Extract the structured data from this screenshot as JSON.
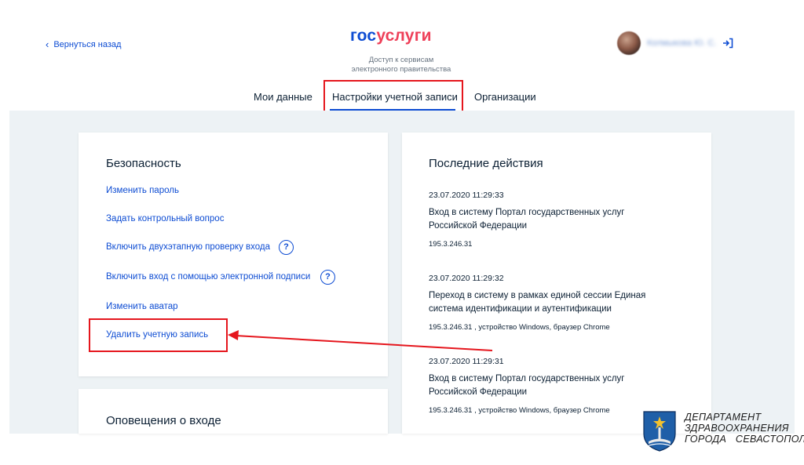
{
  "header": {
    "back_label": "Вернуться назад",
    "logo_part1": "гос",
    "logo_part2": "услуги",
    "tagline_line1": "Доступ к сервисам",
    "tagline_line2": "электронного правительства",
    "user_name": "Колмыкова Ю. С."
  },
  "tabs": [
    {
      "label": "Мои данные",
      "active": false
    },
    {
      "label": "Настройки учетной записи",
      "active": true
    },
    {
      "label": "Организации",
      "active": false
    }
  ],
  "security": {
    "title": "Безопасность",
    "links": [
      {
        "label": "Изменить пароль",
        "help": false
      },
      {
        "label": "Задать контрольный вопрос",
        "help": false
      },
      {
        "label": "Включить двухэтапную проверку входа",
        "help": true
      },
      {
        "label": "Включить вход с помощью электронной подписи",
        "help": true
      },
      {
        "label": "Изменить аватар",
        "help": false
      },
      {
        "label": "Удалить учетную запись",
        "help": false
      }
    ],
    "help_symbol": "?"
  },
  "notifications": {
    "title": "Оповещения о входе"
  },
  "recent": {
    "title": "Последние действия",
    "items": [
      {
        "time": "23.07.2020 11:29:33",
        "text": "Вход в систему Портал государственных услуг Российской Федерации",
        "ip": "195.3.246.31"
      },
      {
        "time": "23.07.2020 11:29:32",
        "text": "Переход в систему в рамках единой сессии Единая система идентификации и аутентификации",
        "ip": "195.3.246.31 , устройство Windows, браузер Chrome"
      },
      {
        "time": "23.07.2020 11:29:31",
        "text": "Вход в систему Портал государственных услуг Российской Федерации",
        "ip": "195.3.246.31 , устройство Windows, браузер Chrome"
      }
    ]
  },
  "watermark": {
    "line1": "ДЕПАРТАМЕНТ",
    "line2": "ЗДРАВООХРАНЕНИЯ",
    "line3": "ГОРОДА   СЕВАСТОПОЛЯ"
  },
  "colors": {
    "brand_blue": "#0d4cd3",
    "brand_red": "#ee3f58",
    "highlight_red": "#e5161d",
    "background_gray": "#edf2f5"
  },
  "icons": {
    "back": "chevron-left-icon",
    "logout": "logout-icon",
    "help": "question-circle-icon",
    "arrow": "annotation-arrow",
    "emblem": "sevastopol-emblem-icon"
  }
}
